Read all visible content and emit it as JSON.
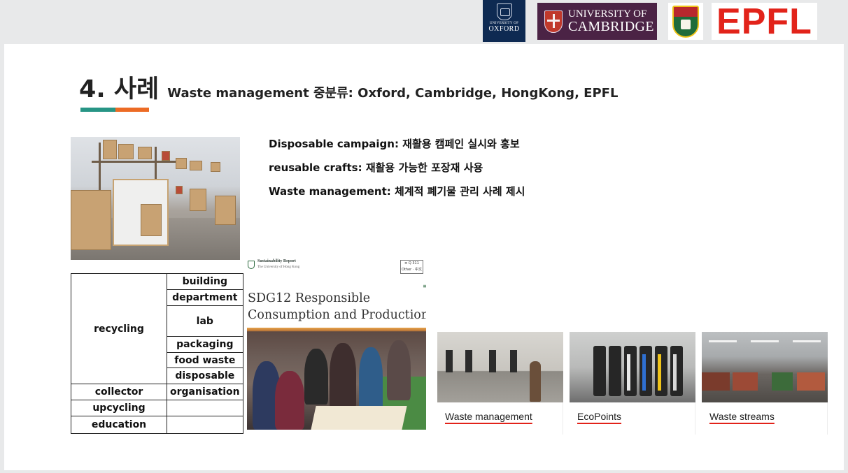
{
  "logos": {
    "oxford": {
      "line1": "UNIVERSITY OF",
      "line2": "OXFORD"
    },
    "cambridge": {
      "line1": "UNIVERSITY OF",
      "line2": "CAMBRIDGE"
    },
    "epfl": {
      "text": "EPFL"
    }
  },
  "slide": {
    "title": "4. 사례",
    "subtitle": "Waste management 중분류: Oxford, Cambridge, HongKong, EPFL",
    "accent_colors": [
      "#279585",
      "#ec6b25"
    ],
    "bullets": [
      "Disposable campaign: 재활용 캠페인 실시와 홍보",
      "reusable crafts: 재활용 가능한 포장재 사용",
      "Waste management: 체계적 폐기물 관리 사례 제시"
    ],
    "table": {
      "rows": [
        {
          "category": "recycling",
          "subs": [
            "building",
            "department",
            "lab",
            "packaging",
            "food waste",
            "disposable"
          ]
        },
        {
          "category": "collector",
          "subs": [
            "organisation"
          ]
        },
        {
          "category": "upcycling",
          "subs": [
            ""
          ]
        },
        {
          "category": "education",
          "subs": [
            ""
          ]
        }
      ]
    },
    "report": {
      "header_title": "Sustainability Report",
      "header_subtitle": "The University of Hong Kong",
      "header_box_top": "≡ Q 311",
      "header_box_bottom": "Other · 中文",
      "menu_icon": "menu-icon",
      "title_line1": "SDG12 Responsible",
      "title_line2": "Consumption and Production"
    },
    "cards": [
      {
        "label": "Waste management"
      },
      {
        "label": "EcoPoints"
      },
      {
        "label": "Waste streams"
      }
    ],
    "epfl_red": "#e2231a"
  }
}
